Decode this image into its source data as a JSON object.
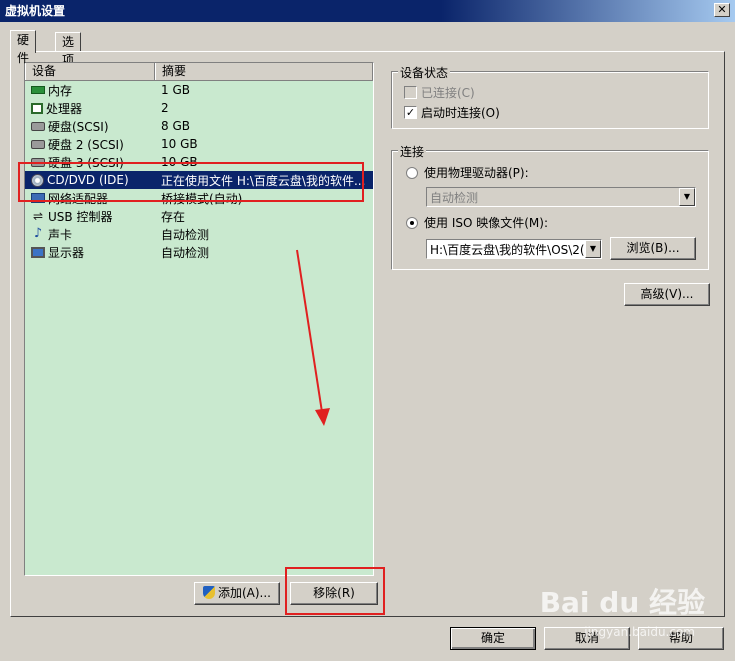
{
  "window": {
    "title": "虚拟机设置",
    "close_glyph": "✕"
  },
  "tabs": [
    {
      "label": "硬件"
    },
    {
      "label": "选项"
    }
  ],
  "device_list": {
    "headers": {
      "device": "设备",
      "summary": "摘要"
    },
    "rows": [
      {
        "icon": "memory-icon",
        "device": "内存",
        "summary": "1 GB"
      },
      {
        "icon": "processor-icon",
        "device": "处理器",
        "summary": "2"
      },
      {
        "icon": "hard-disk-icon",
        "device": "硬盘(SCSI)",
        "summary": "8 GB"
      },
      {
        "icon": "hard-disk-icon",
        "device": "硬盘 2 (SCSI)",
        "summary": "10 GB"
      },
      {
        "icon": "hard-disk-icon",
        "device": "硬盘 3 (SCSI)",
        "summary": "10 GB"
      },
      {
        "icon": "cd-dvd-icon",
        "device": "CD/DVD (IDE)",
        "summary": "正在使用文件 H:\\百度云盘\\我的软件..."
      },
      {
        "icon": "network-adapter-icon",
        "device": "网络适配器",
        "summary": "桥接模式(自动)"
      },
      {
        "icon": "usb-icon",
        "device": "USB 控制器",
        "summary": "存在"
      },
      {
        "icon": "sound-card-icon",
        "device": "声卡",
        "summary": "自动检测"
      },
      {
        "icon": "display-icon",
        "device": "显示器",
        "summary": "自动检测"
      }
    ]
  },
  "buttons": {
    "add": "添加(A)...",
    "remove": "移除(R)",
    "browse": "浏览(B)...",
    "advanced": "高级(V)...",
    "ok": "确定",
    "cancel": "取消",
    "help": "帮助"
  },
  "device_status": {
    "title": "设备状态",
    "connected": {
      "label": "已连接(C)",
      "checked": false,
      "enabled": false
    },
    "connect_at_power_on": {
      "label": "启动时连接(O)",
      "checked": true
    }
  },
  "connection": {
    "title": "连接",
    "physical_drive": {
      "label": "使用物理驱动器(P):",
      "selected": false,
      "combo_value": "自动检测"
    },
    "iso_image": {
      "label": "使用 ISO 映像文件(M):",
      "selected": true,
      "combo_value": "H:\\百度云盘\\我的软件\\OS\\2("
    }
  },
  "watermark": {
    "text": "Bai du 经验",
    "sub": "jingyan.baidu.com"
  },
  "colors": {
    "selection": "#0a246a",
    "list_bg": "#c9e9cf",
    "annotation": "#e02020"
  }
}
